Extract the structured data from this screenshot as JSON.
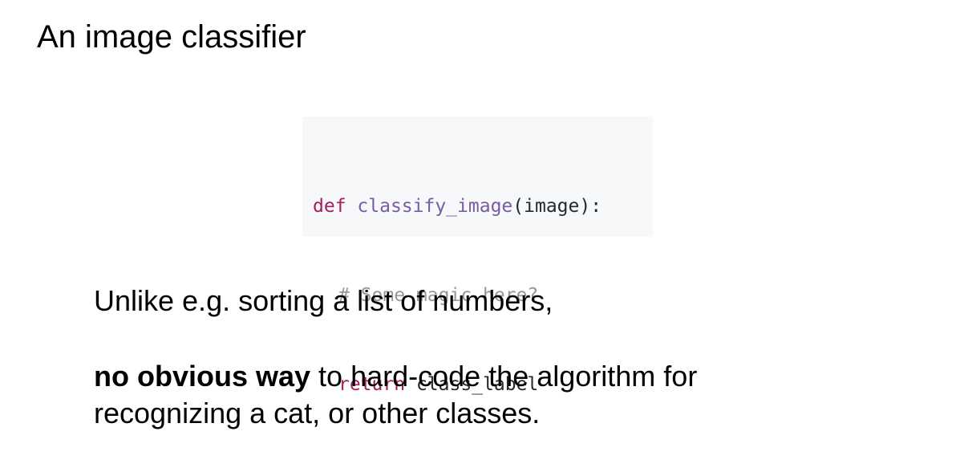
{
  "slide": {
    "title": "An image classifier"
  },
  "code": {
    "line1": {
      "keyword": "def",
      "function_name": "classify_image",
      "signature": "(image):"
    },
    "line2": {
      "comment": "# Some magic here?"
    },
    "line3": {
      "keyword": "return",
      "value": "class_label"
    }
  },
  "body": {
    "line1": "Unlike e.g. sorting a list of numbers,",
    "para2": {
      "bold_text": "no obvious way",
      "text_rest_line1": " to hard-code the algorithm for",
      "text_line2": "recognizing a cat, or other classes."
    }
  },
  "colors": {
    "code_background": "#f6f8fa",
    "keyword": "#a71d5d",
    "function_name": "#795da3",
    "comment": "#969896",
    "code_text": "#24292e"
  }
}
